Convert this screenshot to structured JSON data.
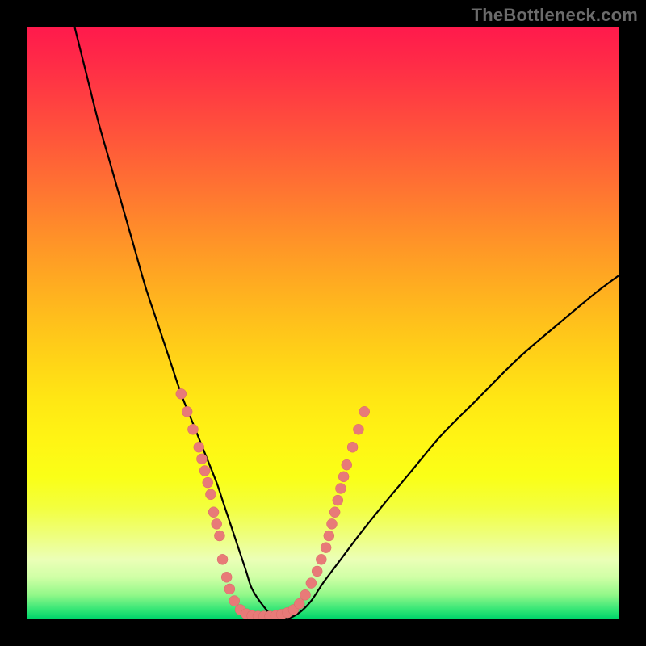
{
  "watermark": {
    "text": "TheBottleneck.com"
  },
  "colors": {
    "curve_stroke": "#000000",
    "marker_fill": "#e87a78",
    "marker_stroke": "#d96a67"
  },
  "chart_data": {
    "type": "line",
    "title": "",
    "xlabel": "",
    "ylabel": "",
    "xlim": [
      0,
      100
    ],
    "ylim": [
      0,
      100
    ],
    "grid": false,
    "legend": false,
    "series": [
      {
        "name": "bottleneck-curve",
        "x": [
          8,
          10,
          12,
          14,
          16,
          18,
          20,
          22,
          24,
          26,
          28,
          30,
          32,
          33,
          34,
          35,
          36,
          37,
          38,
          40,
          42,
          44,
          46,
          48,
          50,
          53,
          56,
          60,
          65,
          70,
          76,
          83,
          90,
          96,
          100
        ],
        "y": [
          100,
          92,
          84,
          77,
          70,
          63,
          56,
          50,
          44,
          38,
          33,
          28,
          23,
          20,
          17,
          14,
          11,
          8,
          5,
          2,
          0,
          0,
          1,
          3,
          6,
          10,
          14,
          19,
          25,
          31,
          37,
          44,
          50,
          55,
          58
        ]
      }
    ],
    "markers": {
      "name": "highlight-dots",
      "points": [
        {
          "x": 26,
          "y": 38
        },
        {
          "x": 27,
          "y": 35
        },
        {
          "x": 28,
          "y": 32
        },
        {
          "x": 29,
          "y": 29
        },
        {
          "x": 29.5,
          "y": 27
        },
        {
          "x": 30,
          "y": 25
        },
        {
          "x": 30.5,
          "y": 23
        },
        {
          "x": 31,
          "y": 21
        },
        {
          "x": 31.5,
          "y": 18
        },
        {
          "x": 32,
          "y": 16
        },
        {
          "x": 32.5,
          "y": 14
        },
        {
          "x": 33,
          "y": 10
        },
        {
          "x": 33.7,
          "y": 7
        },
        {
          "x": 34.2,
          "y": 5
        },
        {
          "x": 35,
          "y": 3
        },
        {
          "x": 36,
          "y": 1.5
        },
        {
          "x": 37,
          "y": 0.8
        },
        {
          "x": 38,
          "y": 0.5
        },
        {
          "x": 39,
          "y": 0.4
        },
        {
          "x": 40,
          "y": 0.4
        },
        {
          "x": 41,
          "y": 0.4
        },
        {
          "x": 42,
          "y": 0.5
        },
        {
          "x": 43,
          "y": 0.7
        },
        {
          "x": 44,
          "y": 1
        },
        {
          "x": 45,
          "y": 1.5
        },
        {
          "x": 46,
          "y": 2.5
        },
        {
          "x": 47,
          "y": 4
        },
        {
          "x": 48,
          "y": 6
        },
        {
          "x": 49,
          "y": 8
        },
        {
          "x": 49.7,
          "y": 10
        },
        {
          "x": 50.5,
          "y": 12
        },
        {
          "x": 51,
          "y": 14
        },
        {
          "x": 51.5,
          "y": 16
        },
        {
          "x": 52,
          "y": 18
        },
        {
          "x": 52.5,
          "y": 20
        },
        {
          "x": 53,
          "y": 22
        },
        {
          "x": 53.5,
          "y": 24
        },
        {
          "x": 54,
          "y": 26
        },
        {
          "x": 55,
          "y": 29
        },
        {
          "x": 56,
          "y": 32
        },
        {
          "x": 57,
          "y": 35
        }
      ]
    }
  }
}
